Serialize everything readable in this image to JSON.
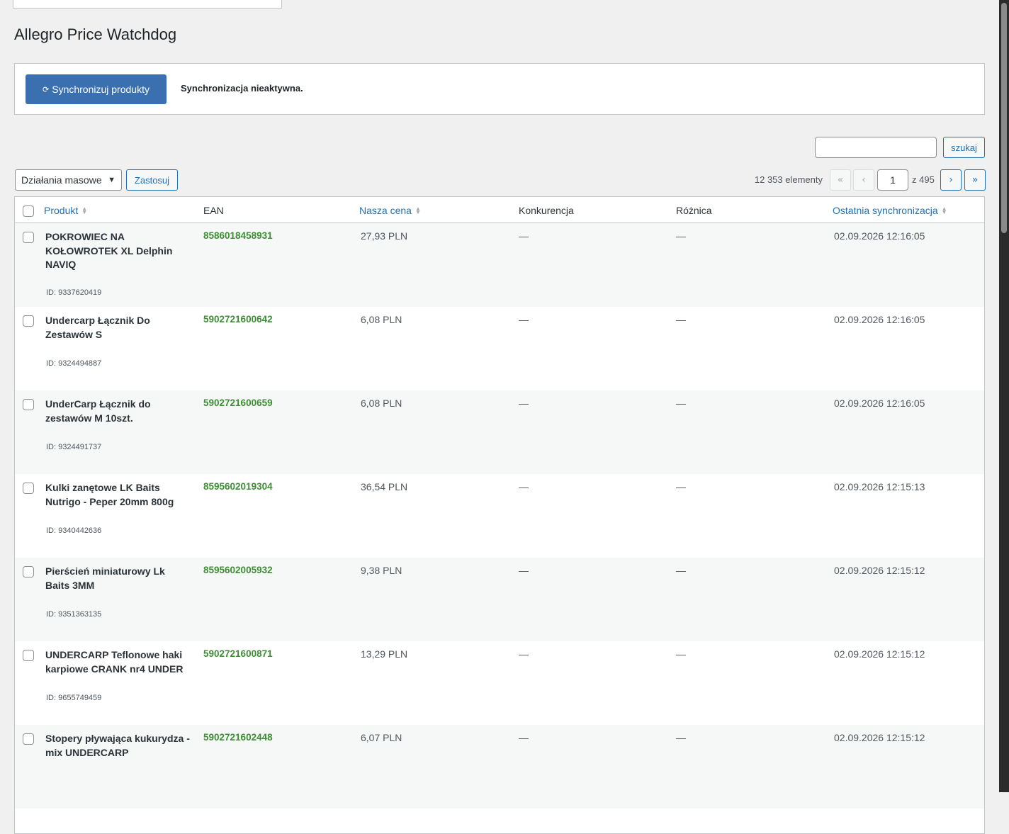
{
  "page": {
    "title": "Allegro Price Watchdog"
  },
  "sync": {
    "button_label": "Synchronizuj produkty",
    "button_icon": "refresh-icon",
    "status": "Synchronizacja nieaktywna."
  },
  "search": {
    "value": "",
    "button_label": "szukaj"
  },
  "bulk": {
    "selected": "Działania masowe",
    "apply_label": "Zastosuj"
  },
  "pagination": {
    "items": "12 353 elementy",
    "first": "«",
    "prev": "‹",
    "current": "1",
    "total": "z 495",
    "next": "›",
    "last": "»"
  },
  "table": {
    "columns": {
      "product": "Produkt",
      "ean": "EAN",
      "price": "Nasza cena",
      "competition": "Konkurencja",
      "difference": "Różnica",
      "last_sync": "Ostatnia synchronizacja"
    },
    "rows": [
      {
        "name": "POKROWIEC NA KOŁOWROTEK XL Delphin NAVIQ",
        "id": "ID: 9337620419",
        "ean": "8586018458931",
        "price": "27,93 PLN",
        "competition": "—",
        "difference": "—",
        "last_sync": "02.09.2026 12:16:05"
      },
      {
        "name": "Undercarp Łącznik Do Zestawów S",
        "id": "ID: 9324494887",
        "ean": "5902721600642",
        "price": "6,08 PLN",
        "competition": "—",
        "difference": "—",
        "last_sync": "02.09.2026 12:16:05"
      },
      {
        "name": "UnderCarp Łącznik do zestawów M 10szt.",
        "id": "ID: 9324491737",
        "ean": "5902721600659",
        "price": "6,08 PLN",
        "competition": "—",
        "difference": "—",
        "last_sync": "02.09.2026 12:16:05"
      },
      {
        "name": "Kulki zanętowe LK Baits Nutrigo - Peper 20mm 800g",
        "id": "ID: 9340442636",
        "ean": "8595602019304",
        "price": "36,54 PLN",
        "competition": "—",
        "difference": "—",
        "last_sync": "02.09.2026 12:15:13"
      },
      {
        "name": "Pierścień miniaturowy Lk Baits 3MM",
        "id": "ID: 9351363135",
        "ean": "8595602005932",
        "price": "9,38 PLN",
        "competition": "—",
        "difference": "—",
        "last_sync": "02.09.2026 12:15:12"
      },
      {
        "name": "UNDERCARP Teflonowe haki karpiowe CRANK nr4 UNDER",
        "id": "ID: 9655749459",
        "ean": "5902721600871",
        "price": "13,29 PLN",
        "competition": "—",
        "difference": "—",
        "last_sync": "02.09.2026 12:15:12"
      },
      {
        "name": "Stopery pływająca kukurydza - mix UNDERCARP",
        "id": "",
        "ean": "5902721602448",
        "price": "6,07 PLN",
        "competition": "—",
        "difference": "—",
        "last_sync": "02.09.2026 12:15:12"
      }
    ]
  }
}
